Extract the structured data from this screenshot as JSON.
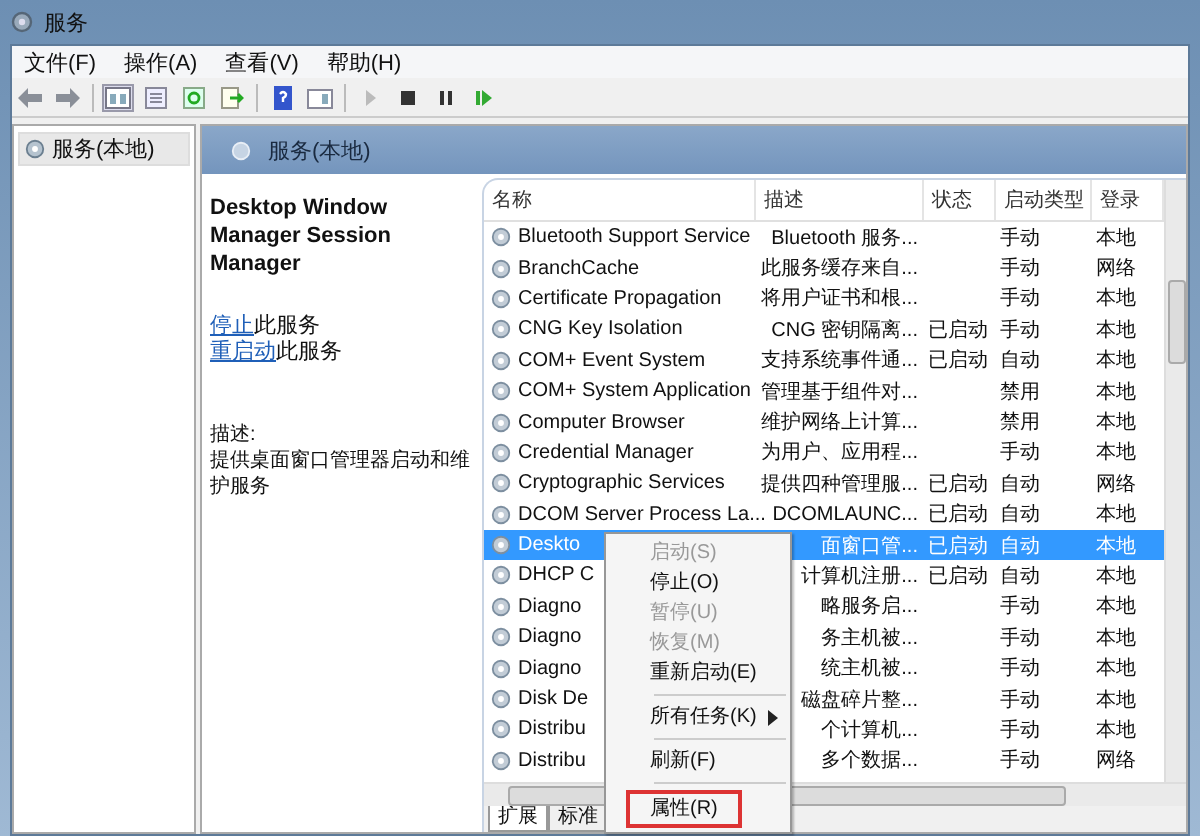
{
  "window": {
    "title": "服务"
  },
  "menu_bar": [
    "文件(F)",
    "操作(A)",
    "查看(V)",
    "帮助(H)"
  ],
  "tree": {
    "items": [
      {
        "label": "服务(本地)",
        "selected": true
      }
    ]
  },
  "pane_header": {
    "title": "服务(本地)"
  },
  "details": {
    "service_name": "Desktop Window Manager Session Manager",
    "actions": [
      {
        "link": "停止",
        "text": "此服务"
      },
      {
        "link": "重启动",
        "text": "此服务"
      }
    ],
    "description_label": "描述:",
    "description": "提供桌面窗口管理器启动和维护服务"
  },
  "table": {
    "columns": [
      "名称",
      "描述",
      "状态",
      "启动类型",
      "登录"
    ],
    "rows": [
      {
        "name": "Bluetooth Support Service",
        "description": "Bluetooth 服务...",
        "status": "",
        "startup": "手动",
        "logon": "本地",
        "selected": false
      },
      {
        "name": "BranchCache",
        "description": "此服务缓存来自...",
        "status": "",
        "startup": "手动",
        "logon": "网络",
        "selected": false
      },
      {
        "name": "Certificate Propagation",
        "description": "将用户证书和根...",
        "status": "",
        "startup": "手动",
        "logon": "本地",
        "selected": false
      },
      {
        "name": "CNG Key Isolation",
        "description": "CNG 密钥隔离...",
        "status": "已启动",
        "startup": "手动",
        "logon": "本地",
        "selected": false
      },
      {
        "name": "COM+ Event System",
        "description": "支持系统事件通...",
        "status": "已启动",
        "startup": "自动",
        "logon": "本地",
        "selected": false
      },
      {
        "name": "COM+ System Application",
        "description": "管理基于组件对...",
        "status": "",
        "startup": "禁用",
        "logon": "本地",
        "selected": false
      },
      {
        "name": "Computer Browser",
        "description": "维护网络上计算...",
        "status": "",
        "startup": "禁用",
        "logon": "本地",
        "selected": false
      },
      {
        "name": "Credential Manager",
        "description": "为用户、应用程...",
        "status": "",
        "startup": "手动",
        "logon": "本地",
        "selected": false
      },
      {
        "name": "Cryptographic Services",
        "description": "提供四种管理服...",
        "status": "已启动",
        "startup": "自动",
        "logon": "网络",
        "selected": false
      },
      {
        "name": "DCOM Server Process La...",
        "description": "DCOMLAUNC...",
        "status": "已启动",
        "startup": "自动",
        "logon": "本地",
        "selected": false
      },
      {
        "name": "Deskto",
        "description": "面窗口管...",
        "status": "已启动",
        "startup": "自动",
        "logon": "本地",
        "selected": true
      },
      {
        "name": "DHCP C",
        "description": "计算机注册...",
        "status": "已启动",
        "startup": "自动",
        "logon": "本地",
        "selected": false
      },
      {
        "name": "Diagno",
        "description": "略服务启...",
        "status": "",
        "startup": "手动",
        "logon": "本地",
        "selected": false
      },
      {
        "name": "Diagno",
        "description": "务主机被...",
        "status": "",
        "startup": "手动",
        "logon": "本地",
        "selected": false
      },
      {
        "name": "Diagno",
        "description": "统主机被...",
        "status": "",
        "startup": "手动",
        "logon": "本地",
        "selected": false
      },
      {
        "name": "Disk De",
        "description": "磁盘碎片整...",
        "status": "",
        "startup": "手动",
        "logon": "本地",
        "selected": false
      },
      {
        "name": "Distribu",
        "description": "个计算机...",
        "status": "",
        "startup": "手动",
        "logon": "本地",
        "selected": false
      },
      {
        "name": "Distribu",
        "description": "多个数据...",
        "status": "",
        "startup": "手动",
        "logon": "网络",
        "selected": false
      }
    ]
  },
  "bottom_tabs": [
    {
      "label": "扩展",
      "selected": true
    },
    {
      "label": "标准",
      "selected": false
    }
  ],
  "context_menu": [
    {
      "kind": "item",
      "label": "启动(S)",
      "disabled": true
    },
    {
      "kind": "item",
      "label": "停止(O)",
      "disabled": false
    },
    {
      "kind": "item",
      "label": "暂停(U)",
      "disabled": true
    },
    {
      "kind": "item",
      "label": "恢复(M)",
      "disabled": true
    },
    {
      "kind": "item",
      "label": "重新启动(E)",
      "disabled": false
    },
    {
      "kind": "separator"
    },
    {
      "kind": "submenu",
      "label": "所有任务(K)",
      "disabled": false
    },
    {
      "kind": "separator"
    },
    {
      "kind": "item",
      "label": "刷新(F)",
      "disabled": false
    },
    {
      "kind": "separator"
    },
    {
      "kind": "item",
      "label": "属性(R)",
      "disabled": false,
      "highlighted": true
    }
  ]
}
